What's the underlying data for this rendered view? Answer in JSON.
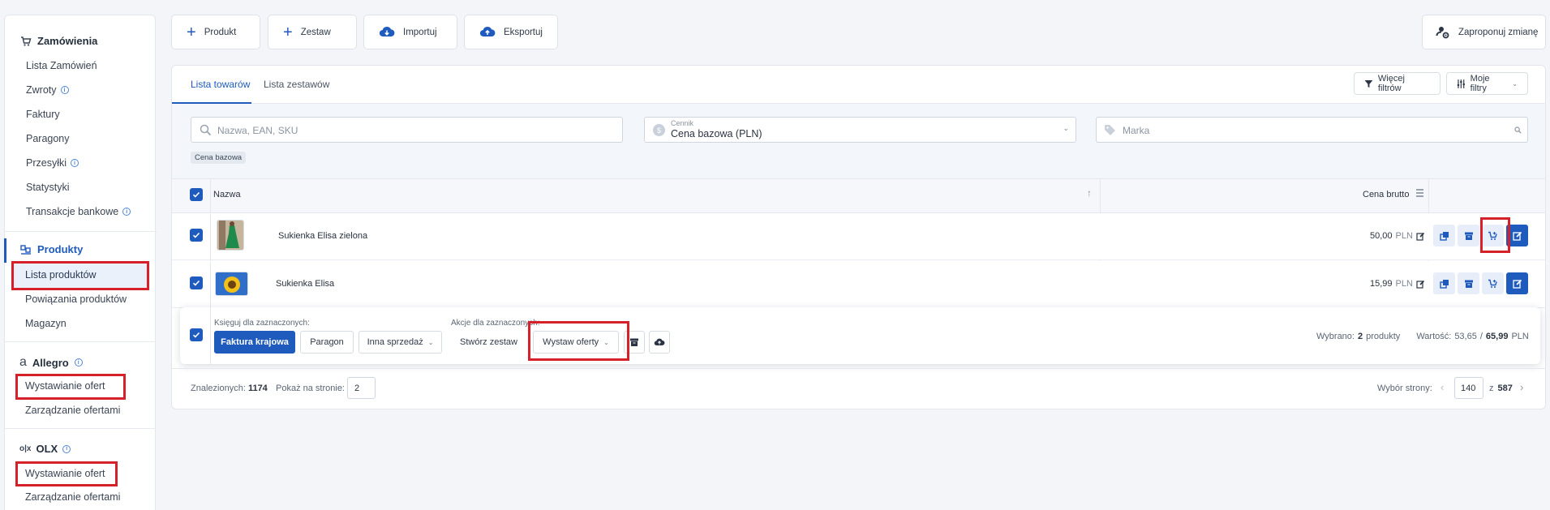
{
  "sidebar": {
    "orders": {
      "title": "Zamówienia",
      "items": [
        {
          "label": "Lista Zamówień"
        },
        {
          "label": "Zwroty",
          "info": true
        },
        {
          "label": "Faktury"
        },
        {
          "label": "Paragony"
        },
        {
          "label": "Przesyłki",
          "info": true
        },
        {
          "label": "Statystyki"
        },
        {
          "label": "Transakcje bankowe",
          "info": true
        }
      ]
    },
    "products": {
      "title": "Produkty",
      "items": [
        {
          "label": "Lista produktów",
          "active": true
        },
        {
          "label": "Powiązania produktów"
        },
        {
          "label": "Magazyn"
        }
      ]
    },
    "allegro": {
      "title": "Allegro",
      "items": [
        {
          "label": "Wystawianie ofert"
        },
        {
          "label": "Zarządzanie ofertami"
        }
      ]
    },
    "olx": {
      "title": "OLX",
      "items": [
        {
          "label": "Wystawianie ofert"
        },
        {
          "label": "Zarządzanie ofertami"
        }
      ]
    }
  },
  "toolbar": {
    "product": "Produkt",
    "set": "Zestaw",
    "import": "Importuj",
    "export": "Eksportuj",
    "suggest": "Zaproponuj zmianę"
  },
  "tabs": {
    "items": "Lista towarów",
    "sets": "Lista zestawów"
  },
  "filters": {
    "more": "Więcej filtrów",
    "mine": "Moje filtry",
    "search_placeholder": "Nazwa, EAN, SKU",
    "pricelist_label": "Cennik",
    "pricelist_value": "Cena bazowa (PLN)",
    "brand_placeholder": "Marka",
    "chip": "Cena bazowa"
  },
  "table": {
    "col_name": "Nazwa",
    "col_price": "Cena brutto",
    "rows": [
      {
        "name": "Sukienka Elisa zielona",
        "price": "50,00",
        "currency": "PLN"
      },
      {
        "name": "Sukienka Elisa",
        "price": "15,99",
        "currency": "PLN"
      }
    ]
  },
  "bulk": {
    "book_label": "Księguj dla zaznaczonych:",
    "invoice": "Faktura krajowa",
    "receipt": "Paragon",
    "other_sale": "Inna sprzedaż",
    "actions_label": "Akcje dla zaznaczonych:",
    "create_set": "Stwórz zestaw",
    "post_offers": "Wystaw oferty",
    "selected_label": "Wybrano:",
    "selected_count": "2",
    "selected_unit": "produkty",
    "value_label": "Wartość:",
    "value_part": "53,65",
    "value_sep": "/",
    "value_total": "65,99",
    "value_currency": "PLN"
  },
  "footer": {
    "found_label": "Znalezionych:",
    "found_count": "1174",
    "per_page_label": "Pokaż na stronie:",
    "per_page": "2",
    "page_label": "Wybór strony:",
    "page": "140",
    "of": "z",
    "total_pages": "587"
  },
  "colors": {
    "accent": "#1e5bbd",
    "highlight": "#d6202a"
  }
}
